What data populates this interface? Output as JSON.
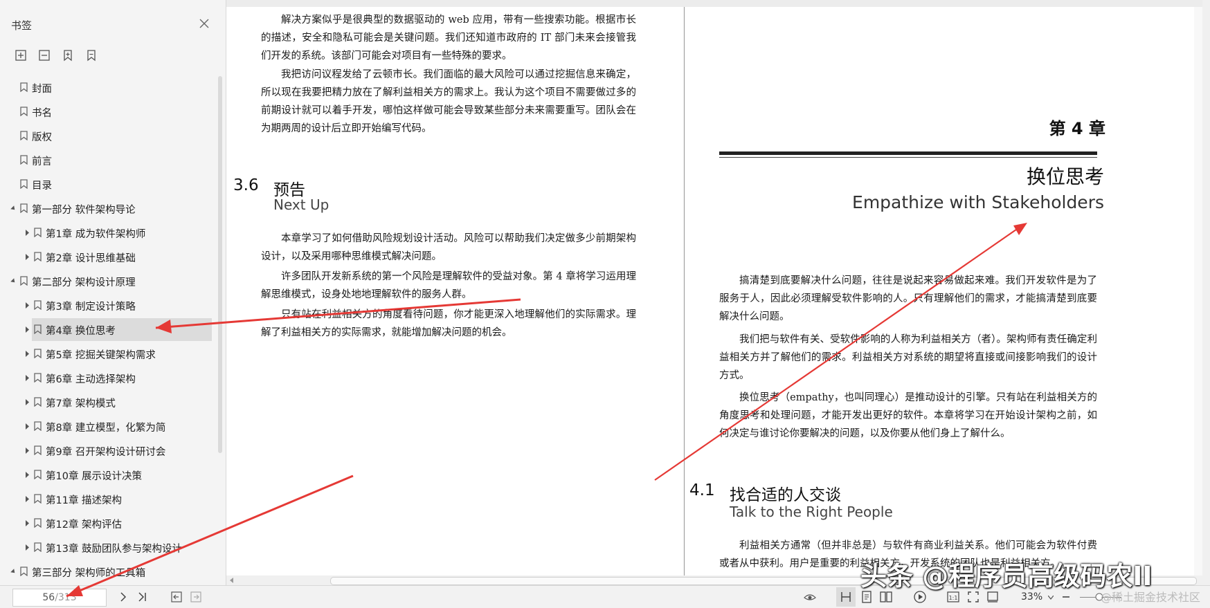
{
  "sidebar": {
    "title": "书签",
    "items": [
      {
        "label": "封面",
        "level": 0,
        "expander": "none"
      },
      {
        "label": "书名",
        "level": 0,
        "expander": "none"
      },
      {
        "label": "版权",
        "level": 0,
        "expander": "none"
      },
      {
        "label": "前言",
        "level": 0,
        "expander": "none"
      },
      {
        "label": "目录",
        "level": 0,
        "expander": "none"
      },
      {
        "label": "第一部分  软件架构导论",
        "level": 0,
        "expander": "expanded"
      },
      {
        "label": "第1章  成为软件架构师",
        "level": 1,
        "expander": "collapsed"
      },
      {
        "label": "第2章  设计思维基础",
        "level": 1,
        "expander": "collapsed"
      },
      {
        "label": "第二部分  架构设计原理",
        "level": 0,
        "expander": "expanded"
      },
      {
        "label": "第3章  制定设计策略",
        "level": 1,
        "expander": "collapsed"
      },
      {
        "label": "第4章  换位思考",
        "level": 1,
        "expander": "collapsed",
        "active": true
      },
      {
        "label": "第5章  挖掘关键架构需求",
        "level": 1,
        "expander": "collapsed"
      },
      {
        "label": "第6章  主动选择架构",
        "level": 1,
        "expander": "collapsed"
      },
      {
        "label": "第7章  架构模式",
        "level": 1,
        "expander": "collapsed"
      },
      {
        "label": "第8章  建立模型，化繁为简",
        "level": 1,
        "expander": "collapsed"
      },
      {
        "label": "第9章  召开架构设计研讨会",
        "level": 1,
        "expander": "collapsed"
      },
      {
        "label": "第10章  展示设计决策",
        "level": 1,
        "expander": "collapsed"
      },
      {
        "label": "第11章  描述架构",
        "level": 1,
        "expander": "collapsed"
      },
      {
        "label": "第12章  架构评估",
        "level": 1,
        "expander": "collapsed"
      },
      {
        "label": "第13章  鼓励团队参与架构设计",
        "level": 1,
        "expander": "collapsed"
      },
      {
        "label": "第三部分  架构师的工具箱",
        "level": 0,
        "expander": "expanded"
      }
    ]
  },
  "left_page": {
    "paras_top": [
      "解决方案似乎是很典型的数据驱动的 web 应用，带有一些搜索功能。根据市长的描述，安全和隐私可能会是关键问题。我们还知道市政府的 IT 部门未来会接管我们开发的系统。该部门可能会对项目有一些特殊的要求。",
      "我把访问议程发给了云顿市长。我们面临的最大风险可以通过挖掘信息来确定，所以现在我要把精力放在了解利益相关方的需求上。我认为这个项目不需要做过多的前期设计就可以着手开发，哪怕这样做可能会导致某些部分未来需要重写。团队会在为期两周的设计后立即开始编写代码。"
    ],
    "section_num": "3.6",
    "section_title": "预告",
    "section_en": "Next Up",
    "paras_bottom": [
      "本章学习了如何借助风险规划设计活动。风险可以帮助我们决定做多少前期架构设计，以及采用哪种思维模式解决问题。",
      "许多团队开发新系统的第一个风险是理解软件的受益对象。第 4 章将学习运用理解思维模式，设身处地地理解软件的服务人群。",
      "只有站在利益相关方的角度看待问题，你才能更深入地理解他们的实际需求。理解了利益相关方的实际需求，就能增加解决问题的机会。"
    ]
  },
  "right_page": {
    "chapter_num": "第 4 章",
    "chapter_title": "换位思考",
    "chapter_en": "Empathize with Stakeholders",
    "paras": [
      "搞清楚到底要解决什么问题，往往是说起来容易做起来难。我们开发软件是为了服务于人，因此必须理解受软件影响的人。只有理解他们的需求，才能搞清楚到底要解决什么问题。",
      "我们把与软件有关、受软件影响的人称为利益相关方（者）。架构师有责任确定利益相关方并了解他们的需求。利益相关方对系统的期望将直接或间接影响我们的设计方式。",
      "换位思考（empathy，也叫同理心）是推动设计的引擎。只有站在利益相关方的角度思考和处理问题，才能开发出更好的软件。本章将学习在开始设计架构之前，如何决定与谁讨论你要解决的问题，以及你要从他们身上了解什么。"
    ],
    "section_num": "4.1",
    "section_title": "找合适的人交谈",
    "section_en": "Talk to the Right People",
    "para_last": "利益相关方通常（但并非总是）与软件有商业利益关系。他们可能会为软件付费或者从中获利。用户是重要的利益相关方，开发系统的团队也是利益相关方。"
  },
  "statusbar": {
    "page_current": "56",
    "page_total": "/313",
    "zoom": "33%"
  },
  "watermark": {
    "main": "头条 @程序员高级码农II",
    "sub": "@稀土掘金技术社区"
  },
  "colors": {
    "arrow": "#e53935",
    "active_bg": "#dcdcdc"
  }
}
